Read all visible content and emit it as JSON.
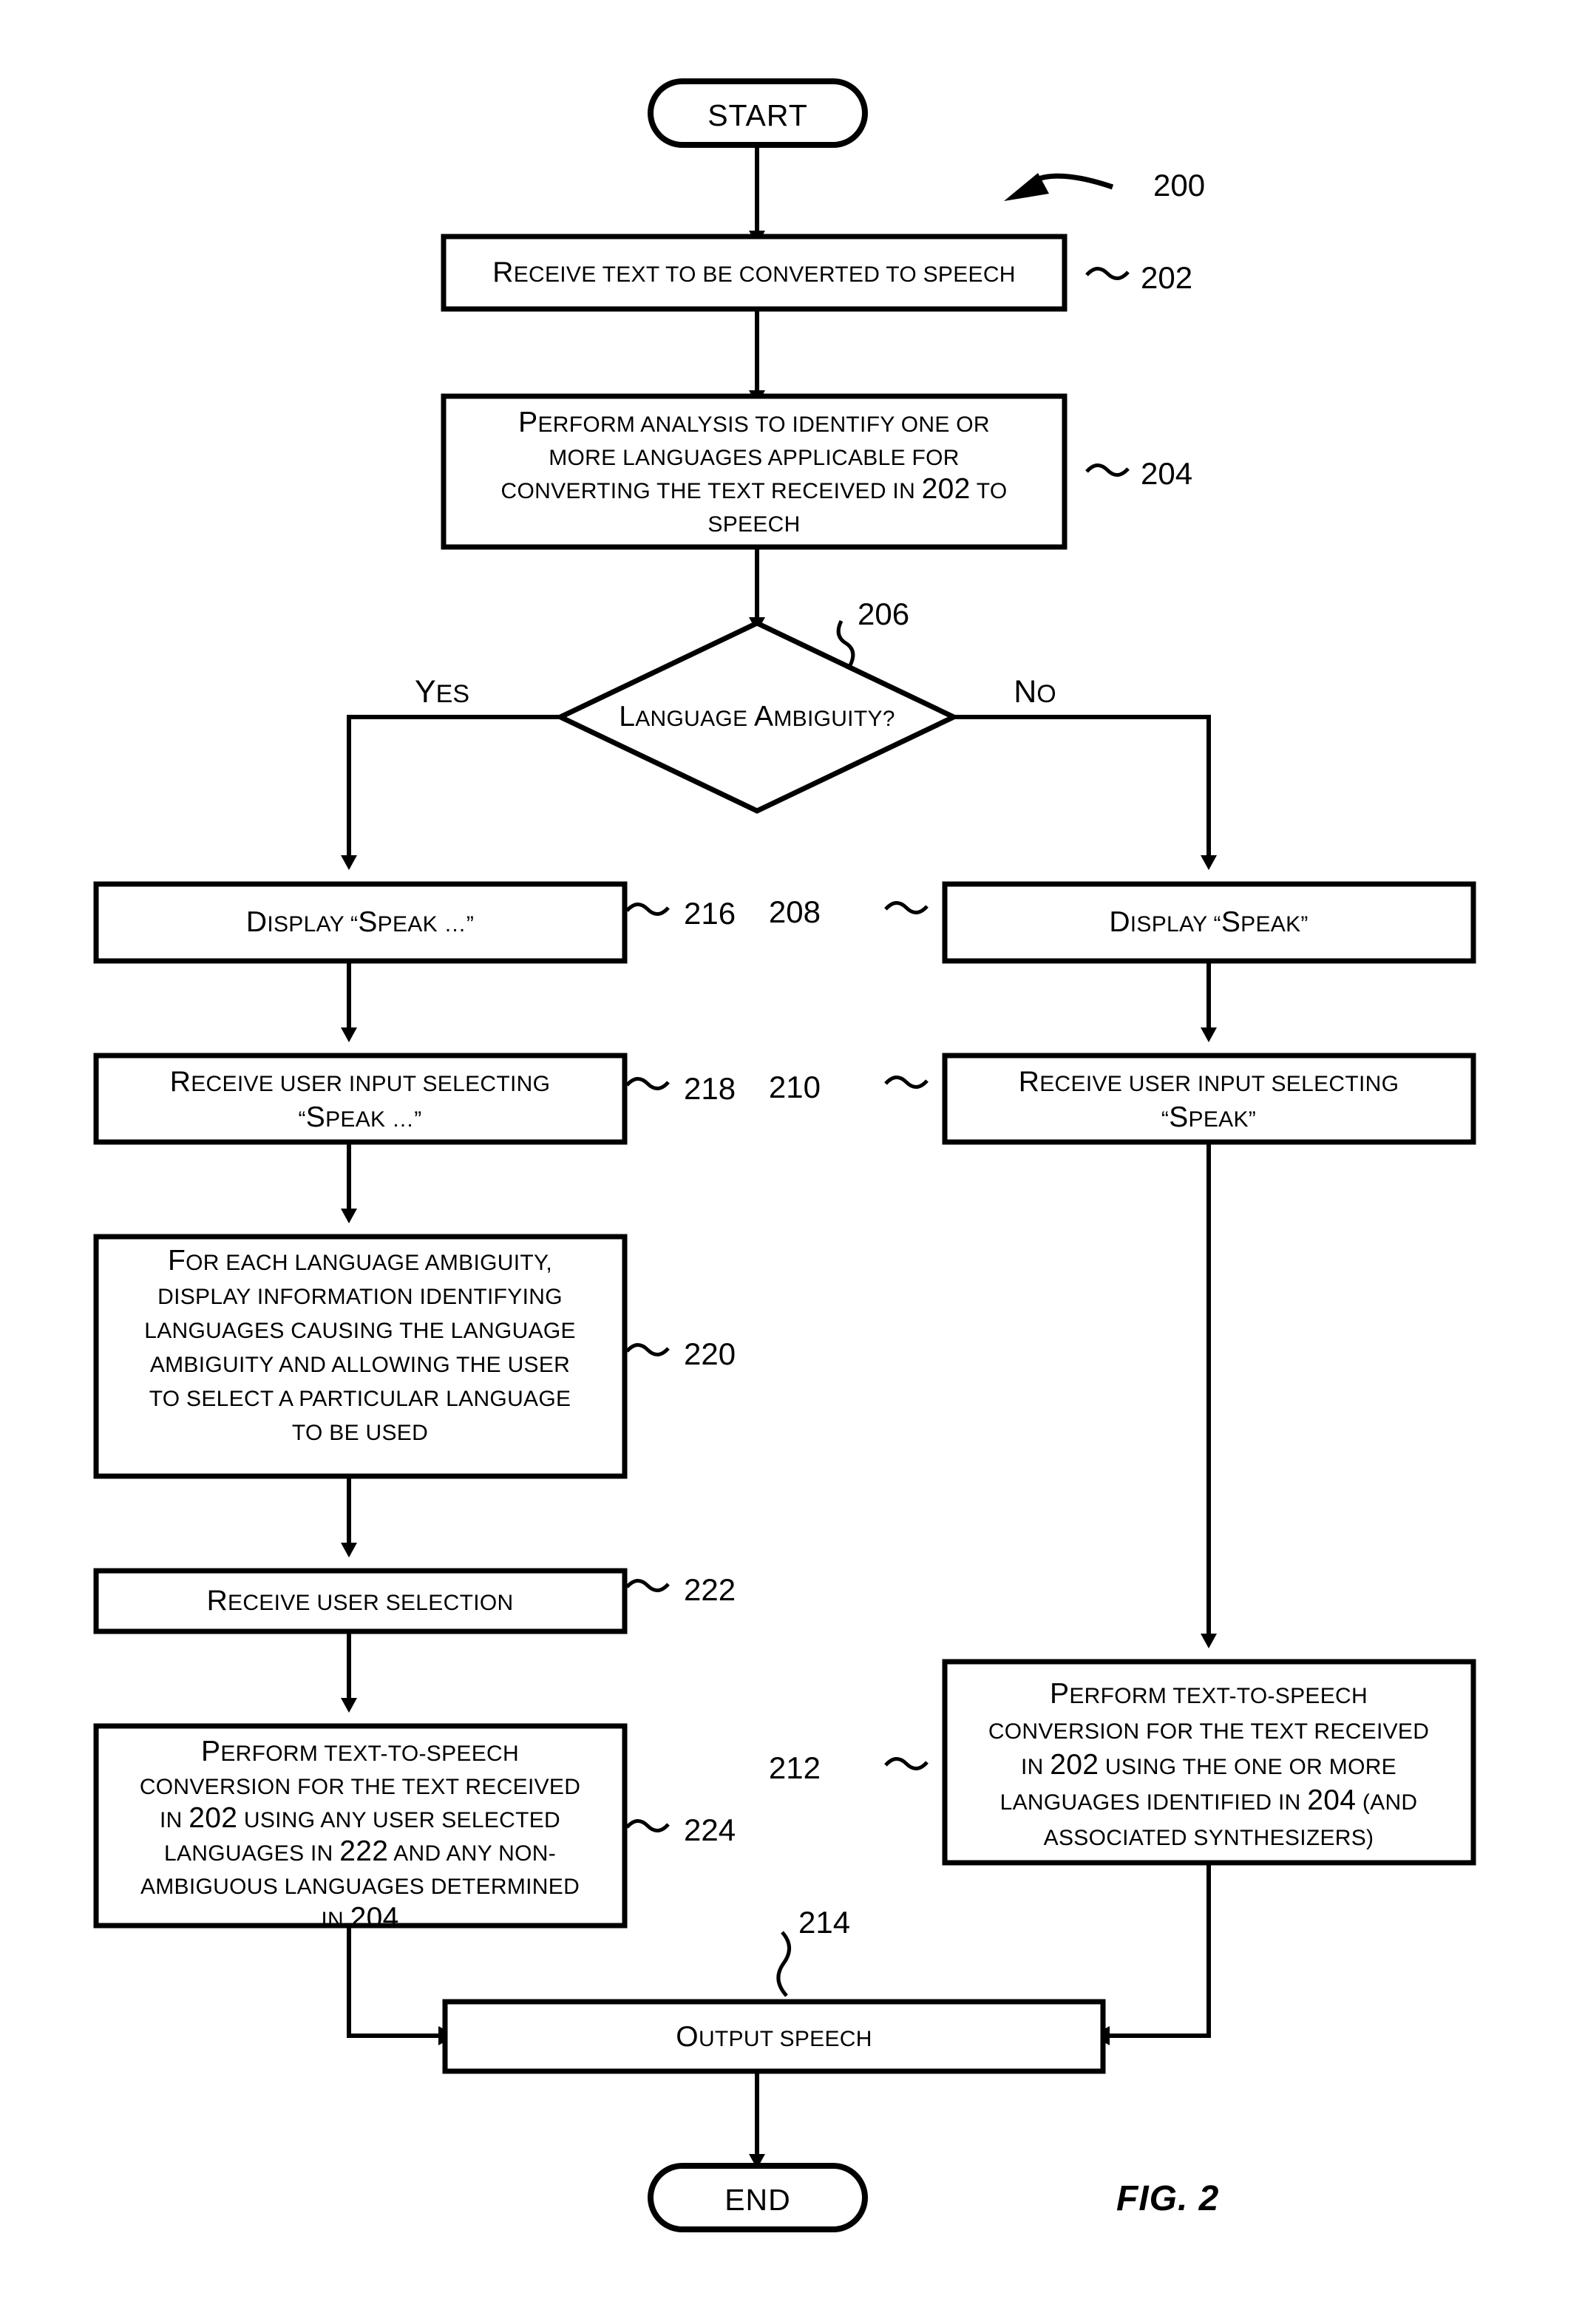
{
  "figure": {
    "label": "FIG. 2",
    "overall_ref": "200"
  },
  "terminals": {
    "start": "START",
    "end": "END"
  },
  "branches": {
    "yes": {
      "cap": "Y",
      "rest": "ES"
    },
    "no": {
      "cap": "N",
      "rest": "O"
    }
  },
  "nodes": {
    "n202": {
      "ref": "202",
      "lines": [
        [
          {
            "cap": "R"
          },
          {
            "t": "ECEIVE TEXT TO BE CONVERTED TO SPEECH"
          }
        ]
      ]
    },
    "n204": {
      "ref": "204",
      "lines": [
        [
          {
            "cap": "P"
          },
          {
            "t": "ERFORM ANALYSIS TO IDENTIFY ONE OR"
          }
        ],
        [
          {
            "t": "MORE LANGUAGES APPLICABLE FOR"
          }
        ],
        [
          {
            "t": "CONVERTING THE TEXT RECEIVED IN "
          },
          {
            "num": "202"
          },
          {
            "t": " TO"
          }
        ],
        [
          {
            "t": "SPEECH"
          }
        ]
      ]
    },
    "n206": {
      "ref": "206",
      "lines": [
        [
          {
            "cap": "L"
          },
          {
            "t": "ANGUAGE "
          },
          {
            "cap": "A"
          },
          {
            "t": "MBIGUITY?"
          }
        ]
      ]
    },
    "n216": {
      "ref": "216",
      "lines": [
        [
          {
            "cap": "D"
          },
          {
            "t": "ISPLAY “"
          },
          {
            "cap": "S"
          },
          {
            "t": "PEAK …”"
          }
        ]
      ]
    },
    "n208": {
      "ref": "208",
      "lines": [
        [
          {
            "cap": "D"
          },
          {
            "t": "ISPLAY “"
          },
          {
            "cap": "S"
          },
          {
            "t": "PEAK”"
          }
        ]
      ]
    },
    "n218": {
      "ref": "218",
      "lines": [
        [
          {
            "cap": "R"
          },
          {
            "t": "ECEIVE USER INPUT SELECTING"
          }
        ],
        [
          {
            "t": "“"
          },
          {
            "cap": "S"
          },
          {
            "t": "PEAK …”"
          }
        ]
      ]
    },
    "n210": {
      "ref": "210",
      "lines": [
        [
          {
            "cap": "R"
          },
          {
            "t": "ECEIVE USER INPUT SELECTING"
          }
        ],
        [
          {
            "t": "“"
          },
          {
            "cap": "S"
          },
          {
            "t": "PEAK”"
          }
        ]
      ]
    },
    "n220": {
      "ref": "220",
      "lines": [
        [
          {
            "cap": "F"
          },
          {
            "t": "OR EACH LANGUAGE AMBIGUITY,"
          }
        ],
        [
          {
            "t": "DISPLAY INFORMATION IDENTIFYING"
          }
        ],
        [
          {
            "t": "LANGUAGES CAUSING THE LANGUAGE"
          }
        ],
        [
          {
            "t": "AMBIGUITY AND ALLOWING THE USER"
          }
        ],
        [
          {
            "t": "TO SELECT A PARTICULAR LANGUAGE"
          }
        ],
        [
          {
            "t": "TO BE USED"
          }
        ]
      ]
    },
    "n222": {
      "ref": "222",
      "lines": [
        [
          {
            "cap": "R"
          },
          {
            "t": "ECEIVE USER SELECTION"
          }
        ]
      ]
    },
    "n224": {
      "ref": "224",
      "lines": [
        [
          {
            "cap": "P"
          },
          {
            "t": "ERFORM TEXT-TO-SPEECH"
          }
        ],
        [
          {
            "t": "CONVERSION FOR THE TEXT RECEIVED"
          }
        ],
        [
          {
            "t": "IN "
          },
          {
            "num": "202"
          },
          {
            "t": " USING ANY USER SELECTED"
          }
        ],
        [
          {
            "t": "LANGUAGES IN "
          },
          {
            "num": "222"
          },
          {
            "t": " AND ANY NON-"
          }
        ],
        [
          {
            "t": "AMBIGUOUS LANGUAGES DETERMINED"
          }
        ],
        [
          {
            "t": "IN "
          },
          {
            "num": "204"
          }
        ]
      ]
    },
    "n212": {
      "ref": "212",
      "lines": [
        [
          {
            "cap": "P"
          },
          {
            "t": "ERFORM TEXT-TO-SPEECH"
          }
        ],
        [
          {
            "t": "CONVERSION FOR THE TEXT RECEIVED"
          }
        ],
        [
          {
            "t": "IN "
          },
          {
            "num": "202"
          },
          {
            "t": " USING THE ONE OR MORE"
          }
        ],
        [
          {
            "t": "LANGUAGES IDENTIFIED IN "
          },
          {
            "num": "204"
          },
          {
            "t": " (AND"
          }
        ],
        [
          {
            "t": "ASSOCIATED SYNTHESIZERS)"
          }
        ]
      ]
    },
    "n214": {
      "ref": "214",
      "lines": [
        [
          {
            "cap": "O"
          },
          {
            "t": "UTPUT SPEECH"
          }
        ]
      ]
    }
  }
}
